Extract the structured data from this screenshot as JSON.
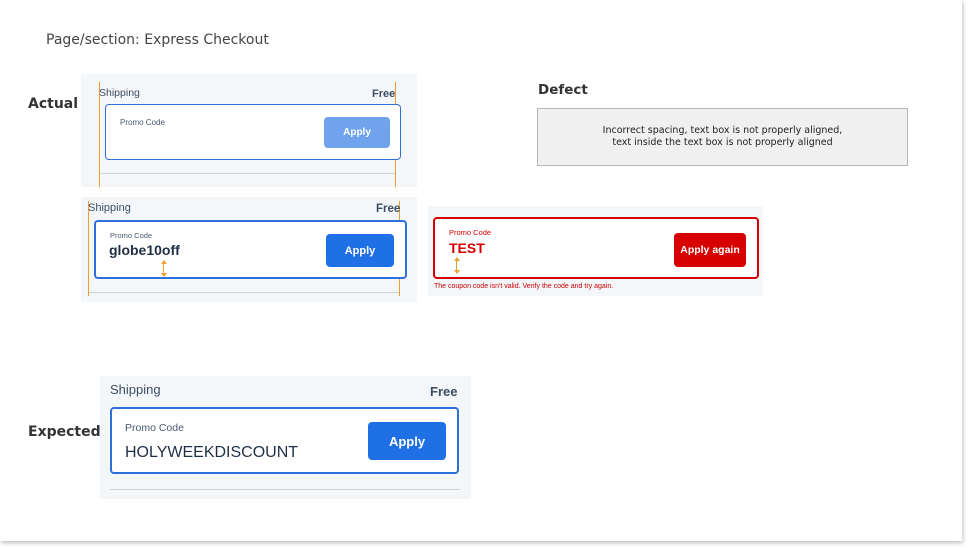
{
  "page_title": "Page/section: Express Checkout",
  "labels": {
    "actual": "Actual",
    "expected": "Expected"
  },
  "defect": {
    "title": "Defect",
    "line1": "Incorrect spacing, text box is not properly aligned,",
    "line2": "text inside the text box is not properly aligned"
  },
  "actual_top": {
    "shipping": "Shipping",
    "free": "Free",
    "promo_label": "Promo Code",
    "button": "Apply"
  },
  "actual_filled": {
    "shipping": "Shipping",
    "free": "Free",
    "promo_label": "Promo Code",
    "value": "globe10off",
    "button": "Apply"
  },
  "actual_error": {
    "promo_label": "Promo Code",
    "value": "TEST",
    "button": "Apply again",
    "error": "The coupon code isn't valid. Verify the code and try again."
  },
  "expected": {
    "shipping": "Shipping",
    "free": "Free",
    "promo_label": "Promo Code",
    "value": "HOLYWEEKDISCOUNT",
    "button": "Apply"
  },
  "colors": {
    "panel_bg": "#f3f7fa",
    "accent_blue": "#2f6fd9",
    "button_blue_light": "#6fa3ec",
    "button_blue": "#1f6fe5",
    "error_red": "#d60000",
    "guide_orange": "#f0a030"
  }
}
